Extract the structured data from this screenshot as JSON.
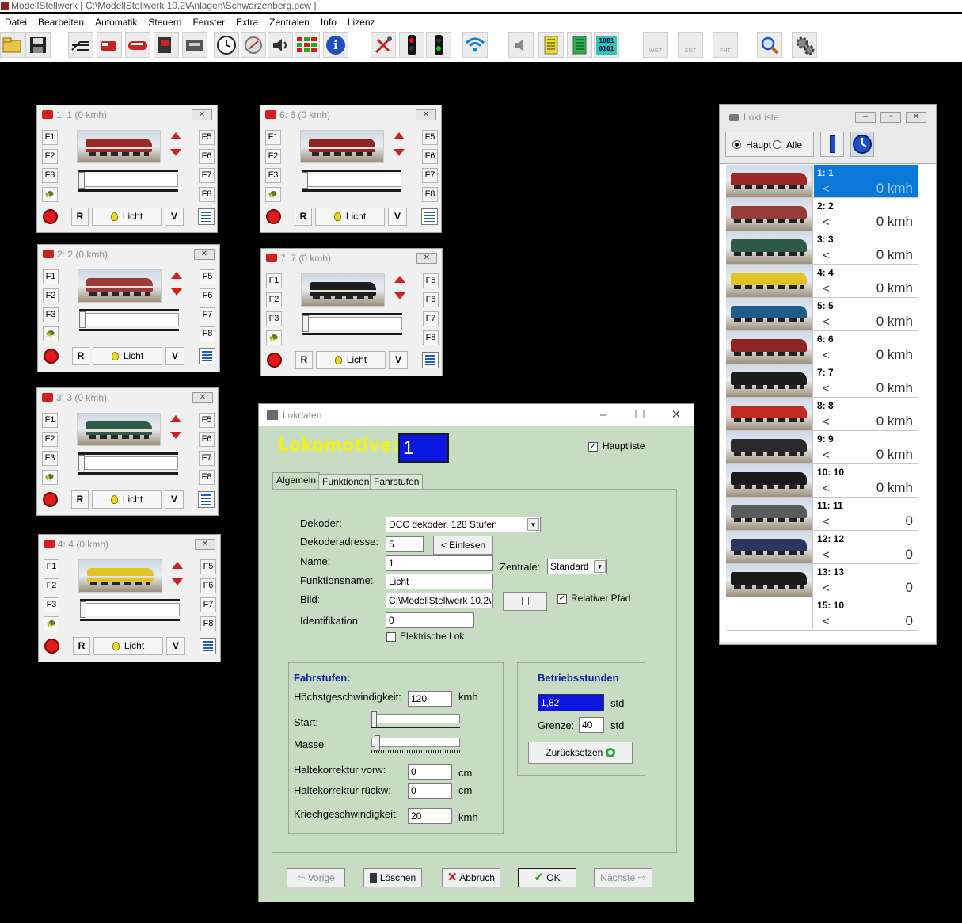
{
  "app": {
    "title": "ModellStellwerk [ C:\\ModellStellwerk 10.2\\Anlagen\\Schwarzenberg.pcw ]",
    "menu": [
      "Datei",
      "Bearbeiten",
      "Automatik",
      "Steuern",
      "Fenster",
      "Extra",
      "Zentralen",
      "Info",
      "Lizenz"
    ]
  },
  "toolbar": {
    "icons": [
      "open-folder-icon",
      "save-icon",
      "track-plan-icon",
      "loco-icon",
      "train-icon",
      "loco-list-icon",
      "panel-icon",
      "clock-icon",
      "compass-icon",
      "sound-icon",
      "grid-icon",
      "info-icon",
      "settings-tools-icon",
      "signal-red-icon",
      "signal-green-icon",
      "wifi-icon",
      "speaker-icon",
      "module-yellow-icon",
      "module-green-icon",
      "binary-icon",
      "wgt-icon",
      "sgt-icon",
      "fht-icon",
      "search-icon",
      "gear-icon"
    ],
    "info_glyph": "i",
    "binary_text": "1001 0101",
    "wgt_text": "WGT",
    "sgt_text": "SGT",
    "fht_text": "FHT"
  },
  "controllers": [
    {
      "title": "1: 1 (0 kmh)",
      "f": [
        "F1",
        "F2",
        "F3",
        "F5",
        "F6",
        "F7",
        "F8"
      ],
      "r": "R",
      "licht": "Licht",
      "v": "V",
      "loco_color": "#9c2828"
    },
    {
      "title": "2: 2 (0 kmh)",
      "f": [
        "F1",
        "F2",
        "F3",
        "F5",
        "F6",
        "F7",
        "F8"
      ],
      "r": "R",
      "licht": "Licht",
      "v": "V",
      "loco_color": "#9a3b3b"
    },
    {
      "title": "3: 3 (0 kmh)",
      "f": [
        "F1",
        "F2",
        "F3",
        "F5",
        "F6",
        "F7",
        "F8"
      ],
      "r": "R",
      "licht": "Licht",
      "v": "V",
      "loco_color": "#2f5a45"
    },
    {
      "title": "4: 4 (0 kmh)",
      "f": [
        "F1",
        "F2",
        "F3",
        "F5",
        "F6",
        "F7",
        "F8"
      ],
      "r": "R",
      "licht": "Licht",
      "v": "V",
      "loco_color": "#e3c226"
    },
    {
      "title": "6: 6 (0 kmh)",
      "f": [
        "F1",
        "F2",
        "F3",
        "F5",
        "F6",
        "F7",
        "F8"
      ],
      "r": "R",
      "licht": "Licht",
      "v": "V",
      "loco_color": "#8f2424"
    },
    {
      "title": "7: 7 (0 kmh)",
      "f": [
        "F1",
        "F2",
        "F3",
        "F5",
        "F6",
        "F7",
        "F8"
      ],
      "r": "R",
      "licht": "Licht",
      "v": "V",
      "loco_color": "#1c1c1c"
    }
  ],
  "lokliste": {
    "title": "LokListe",
    "radio_haupt": "Haupt",
    "radio_alle": "Alle",
    "rows": [
      {
        "id": "1: 1",
        "dir": "<",
        "speed": "0 kmh",
        "color": "#9c2828",
        "selected": true
      },
      {
        "id": "2: 2",
        "dir": "<",
        "speed": "0 kmh",
        "color": "#9a3b3b"
      },
      {
        "id": "3: 3",
        "dir": "<",
        "speed": "0 kmh",
        "color": "#2f5a45"
      },
      {
        "id": "4: 4",
        "dir": "<",
        "speed": "0 kmh",
        "color": "#e3c226"
      },
      {
        "id": "5: 5",
        "dir": "<",
        "speed": "0 kmh",
        "color": "#1e5c8a"
      },
      {
        "id": "6: 6",
        "dir": "<",
        "speed": "0 kmh",
        "color": "#8f2424"
      },
      {
        "id": "7: 7",
        "dir": "<",
        "speed": "0 kmh",
        "color": "#1c1c1c"
      },
      {
        "id": "8: 8",
        "dir": "<",
        "speed": "0 kmh",
        "color": "#c42a24"
      },
      {
        "id": "9: 9",
        "dir": "<",
        "speed": "0 kmh",
        "color": "#2a2a2a"
      },
      {
        "id": "10: 10",
        "dir": "<",
        "speed": "0 kmh",
        "color": "#1a1a1a"
      },
      {
        "id": "11: 11",
        "dir": "<",
        "speed": "0",
        "color": "#5b5b5b"
      },
      {
        "id": "12: 12",
        "dir": "<",
        "speed": "0",
        "color": "#2a3560"
      },
      {
        "id": "13: 13",
        "dir": "<",
        "speed": "0",
        "color": "#1a1a1a"
      },
      {
        "id": "15: 10",
        "dir": "<",
        "speed": "0",
        "color": ""
      }
    ]
  },
  "lokdaten": {
    "title": "Lokdaten",
    "heading": "Lokomotive:",
    "loco_number": "1",
    "hauptliste": "Hauptliste",
    "tabs": [
      "Algemein",
      "Funktionen",
      "Fahrstufen"
    ],
    "dekoder_label": "Dekoder:",
    "dekoder_value": "DCC dekoder, 128 Stufen",
    "dekoderadresse_label": "Dekoderadresse:",
    "dekoderadresse_value": "5",
    "einlesen": "< Einlesen",
    "name_label": "Name:",
    "name_value": "1",
    "zentrale_label": "Zentrale:",
    "zentrale_value": "Standard",
    "funktionsname_label": "Funktionsname:",
    "funktionsname_value": "Licht",
    "bild_label": "Bild:",
    "bild_value": "C:\\ModellStellwerk 10.2\\Lo",
    "relativer_pfad": "Relativer Pfad",
    "identifikation_label": "Identifikation",
    "identifikation_value": "0",
    "elektrische_lok": "Elektrische Lok",
    "fahrstufen_title": "Fahrstufen:",
    "hoechst_label": "Höchstgeschwindigkeit:",
    "hoechst_value": "120",
    "kmh": "kmh",
    "start_label": "Start:",
    "masse_label": "Masse",
    "halte_vorw_label": "Haltekorrektur vorw:",
    "halte_vorw_value": "0",
    "halte_rueck_label": "Haltekorrektur rückw:",
    "halte_rueck_value": "0",
    "cm": "cm",
    "kriech_label": "Kriechgeschwindigkeit:",
    "kriech_value": "20",
    "betrieb_title": "Betriebsstunden",
    "betrieb_value": "1,82",
    "std": "std",
    "grenze_label": "Grenze:",
    "grenze_value": "40",
    "zuruecksetzen": "Zurücksetzen",
    "vorige": "Vorige",
    "loeschen": "Löschen",
    "abbruch": "Abbruch",
    "ok": "OK",
    "naechste": "Nächste"
  }
}
